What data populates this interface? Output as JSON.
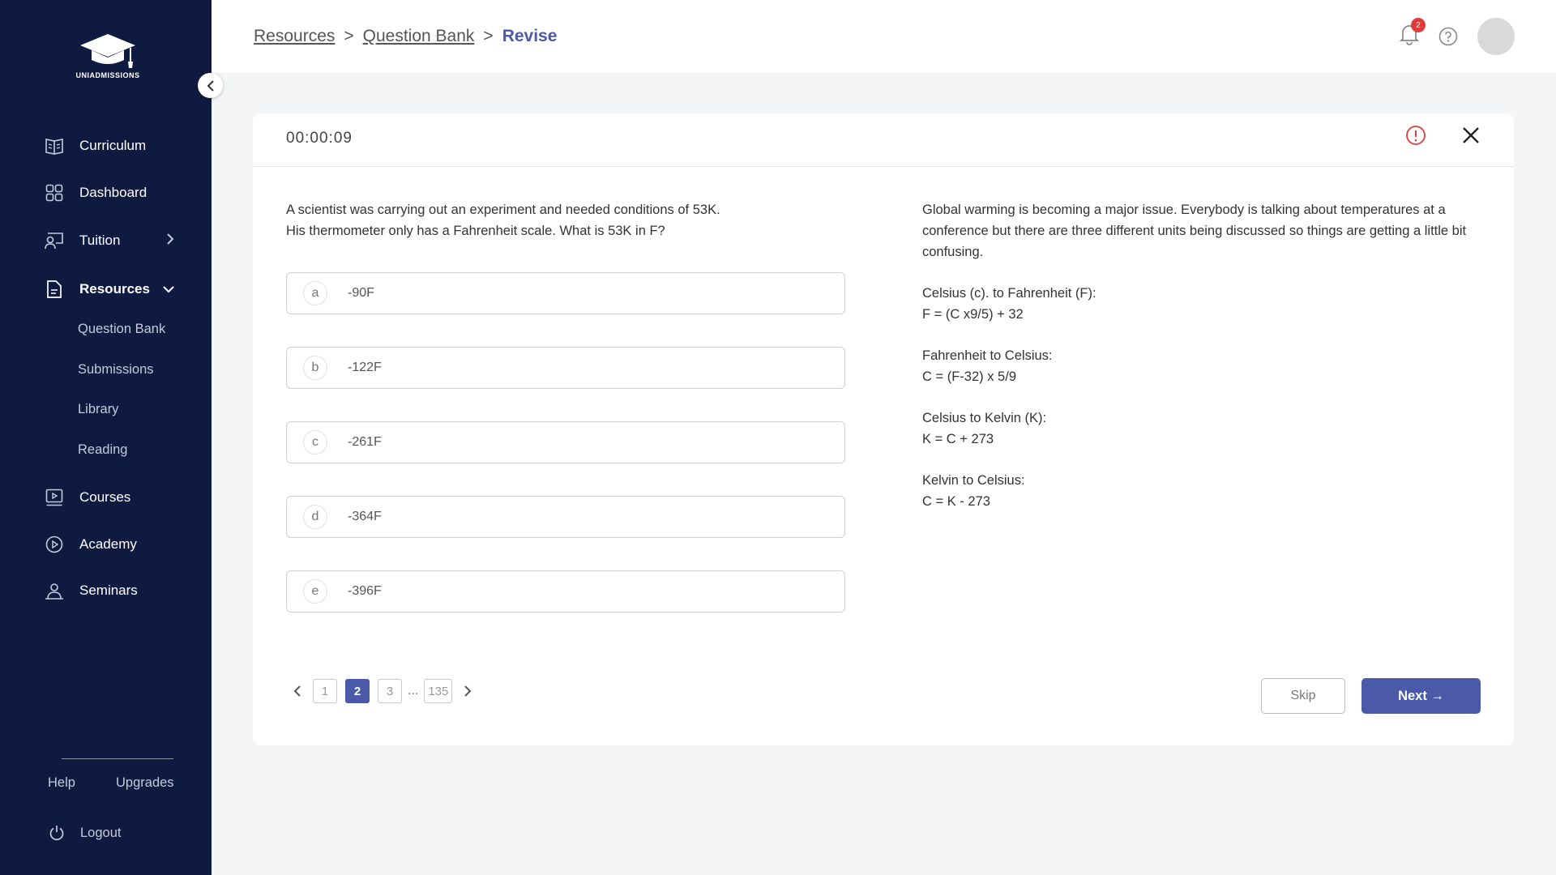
{
  "sidebar": {
    "logo_text": "UNIADMISSIONS",
    "items": [
      {
        "label": "Curriculum",
        "icon": "book-icon"
      },
      {
        "label": "Dashboard",
        "icon": "grid-icon"
      },
      {
        "label": "Tuition",
        "icon": "tutor-icon"
      },
      {
        "label": "Resources",
        "icon": "document-icon"
      },
      {
        "label": "Courses",
        "icon": "play-screen-icon"
      },
      {
        "label": "Academy",
        "icon": "play-circle-icon"
      },
      {
        "label": "Seminars",
        "icon": "presenter-icon"
      }
    ],
    "resources_sub": [
      "Question Bank",
      "Submissions",
      "Library",
      "Reading"
    ],
    "footer": {
      "help": "Help",
      "upgrades": "Upgrades",
      "logout": "Logout"
    }
  },
  "header": {
    "breadcrumb": [
      "Resources",
      "Question Bank",
      "Revise"
    ],
    "notifications_count": "2"
  },
  "quiz": {
    "timer": "00:00:09",
    "question_line1": "A scientist was carrying out an experiment and needed conditions of 53K.",
    "question_line2": "His thermometer only has a Fahrenheit scale. What is 53K in F?",
    "options": [
      {
        "letter": "a",
        "value": "-90F"
      },
      {
        "letter": "b",
        "value": "-122F"
      },
      {
        "letter": "c",
        "value": "-261F"
      },
      {
        "letter": "d",
        "value": "-364F"
      },
      {
        "letter": "e",
        "value": "-396F"
      }
    ],
    "passage": {
      "intro": "Global warming is becoming a major issue. Everybody is talking about temperatures at a conference but there are three different units being discussed so things are getting a little bit confusing.",
      "f1_title": "Celsius (c). to Fahrenheit (F):",
      "f1_formula": "F = (C x9/5) + 32",
      "f2_title": "Fahrenheit to Celsius:",
      "f2_formula": "C = (F-32) x 5/9",
      "f3_title": "Celsius to Kelvin (K):",
      "f3_formula": "K = C + 273",
      "f4_title": "Kelvin to Celsius:",
      "f4_formula": "C = K - 273"
    },
    "pagination": {
      "pages": [
        "1",
        "2",
        "3",
        "135"
      ],
      "ellipsis": "...",
      "current": "2"
    },
    "skip_label": "Skip",
    "next_label": "Next →"
  },
  "colors": {
    "sidebar_bg": "#0f1a40",
    "accent": "#4a5aa8",
    "badge": "#e03b3b",
    "report": "#e03b3b"
  }
}
